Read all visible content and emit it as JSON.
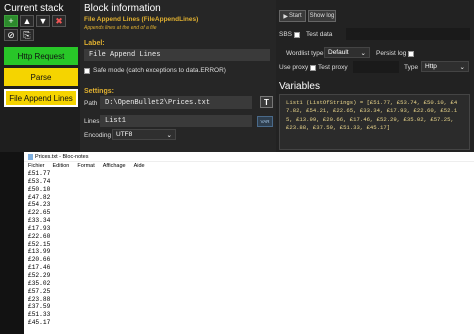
{
  "stack": {
    "title": "Current stack",
    "blocks": [
      {
        "label": "Http Request",
        "color": "#28c628"
      },
      {
        "label": "Parse",
        "color": "#f5d400"
      },
      {
        "label": "File Append Lines",
        "color": "#f5d400"
      }
    ],
    "toolbar_icons": [
      "add-icon",
      "up-arrow-icon",
      "down-arrow-icon",
      "delete-icon",
      "disable-icon",
      "clone-icon"
    ]
  },
  "block_info": {
    "title": "Block information",
    "block_name": "File Append Lines (FileAppendLines)",
    "description": "Appends lines at the end of a file",
    "label_heading": "Label:",
    "label_value": "File Append Lines",
    "safe_mode": "Safe mode (catch exceptions to data.ERROR)",
    "settings_heading": "Settings:",
    "path_label": "Path",
    "path_value": "D:\\OpenBullet2\\Prices.txt",
    "lines_label": "Lines",
    "lines_value": "List1",
    "var_btn": "VAR",
    "encoding_label": "Encoding",
    "encoding_value": "UTF8",
    "t_btn": "T"
  },
  "debug": {
    "start_btn": "Start",
    "showlog_btn": "Show log",
    "sbs_label": "SBS",
    "testdata_label": "Test data",
    "wordlist_label": "Wordlist type",
    "wordlist_value": "Default",
    "persist_label": "Persist log",
    "useproxy_label": "Use proxy",
    "testproxy_label": "Test proxy",
    "type_label": "Type",
    "type_value": "Http",
    "variables_title": "Variables",
    "variables_text": "List1 (ListOfStrings) = [£51.77, £53.74, £50.10, £47.82, £54.21, £22.65, £33.34, £17.93, £22.60, £52.15, £13.99, £20.66, £17.46, £52.29, £35.02, £57.25, £23.88, £37.59, £51.33, £45.17]"
  },
  "notepad": {
    "title": "Prices.txt - Bloc-notes",
    "menu": [
      "Fichier",
      "Edition",
      "Format",
      "Affichage",
      "Aide"
    ],
    "lines": [
      "£51.77",
      "£53.74",
      "£50.10",
      "£47.82",
      "£54.23",
      "£22.65",
      "£33.34",
      "£17.93",
      "£22.60",
      "£52.15",
      "£13.99",
      "£20.66",
      "£17.46",
      "£52.29",
      "£35.02",
      "£57.25",
      "£23.88",
      "£37.59",
      "£51.33",
      "£45.17"
    ]
  }
}
